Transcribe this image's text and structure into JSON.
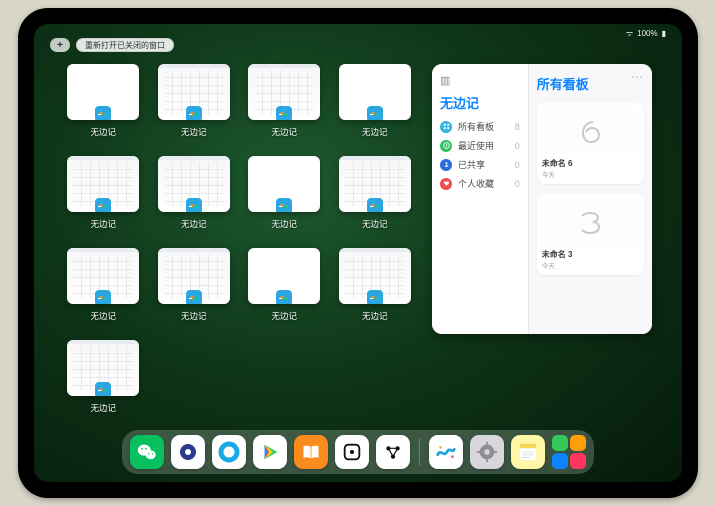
{
  "status": {
    "wifi": "⋯",
    "battery": "100%"
  },
  "topbar": {
    "add_label": "+",
    "reopen_label": "重新打开已关闭的窗口"
  },
  "thumbs": {
    "label": "无边记",
    "items": [
      {
        "kind": "blank"
      },
      {
        "kind": "cal"
      },
      {
        "kind": "cal"
      },
      {
        "kind": "blank"
      },
      {
        "kind": "cal"
      },
      {
        "kind": "cal"
      },
      {
        "kind": "blank"
      },
      {
        "kind": "cal"
      },
      {
        "kind": "cal"
      },
      {
        "kind": "cal"
      },
      {
        "kind": "blank"
      },
      {
        "kind": "cal"
      },
      {
        "kind": "cal"
      }
    ]
  },
  "panel": {
    "title": "无边记",
    "right_title": "所有看板",
    "more": "⋯",
    "nav": [
      {
        "icon": "grid",
        "color": "#2fb4e0",
        "label": "所有看板",
        "count": 8
      },
      {
        "icon": "clock",
        "color": "#30c263",
        "label": "最近使用",
        "count": 0
      },
      {
        "icon": "share",
        "color": "#2a6ddc",
        "label": "已共享",
        "count": 0
      },
      {
        "icon": "heart",
        "color": "#ef4e4e",
        "label": "个人收藏",
        "count": 0
      }
    ],
    "boards": [
      {
        "title": "未命名 6",
        "subtitle": "今天",
        "digit": "6"
      },
      {
        "title": "未命名 3",
        "subtitle": "今天",
        "digit": "3"
      }
    ]
  },
  "dock": [
    {
      "name": "wechat",
      "bg": "#07c160",
      "glyph": "wechat"
    },
    {
      "name": "browser1",
      "bg": "#ffffff",
      "glyph": "ringblue"
    },
    {
      "name": "browser2",
      "bg": "#ffffff",
      "glyph": "ringcyan"
    },
    {
      "name": "play",
      "bg": "#ffffff",
      "glyph": "play"
    },
    {
      "name": "books",
      "bg": "#fa8b1c",
      "glyph": "books"
    },
    {
      "name": "dice",
      "bg": "#ffffff",
      "glyph": "dice"
    },
    {
      "name": "dots",
      "bg": "#ffffff",
      "glyph": "dots"
    },
    {
      "name": "freeform",
      "bg": "#ffffff",
      "glyph": "freeform"
    },
    {
      "name": "settings",
      "bg": "#d7d7db",
      "glyph": "gear"
    },
    {
      "name": "notes",
      "bg": "#fff6a6",
      "glyph": "notes"
    },
    {
      "name": "stack",
      "bg": "",
      "glyph": "stack"
    }
  ]
}
